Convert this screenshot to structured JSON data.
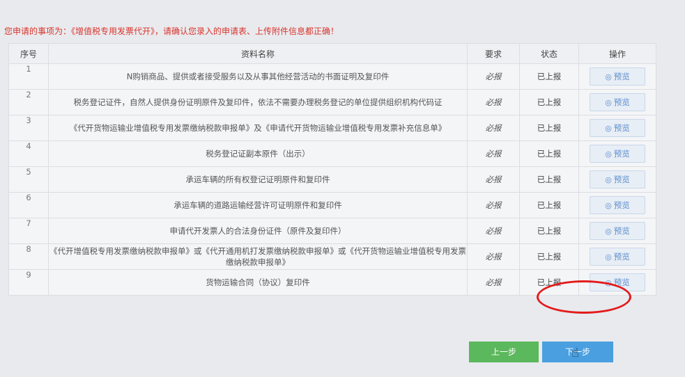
{
  "notice": {
    "prefix": "您申请的事项为：",
    "item": "《增值税专用发票代开》",
    "suffix": "，请确认您录入的申请表、上传附件信息都正确！"
  },
  "table": {
    "headers": {
      "index": "序号",
      "name": "资料名称",
      "required": "要求",
      "status": "状态",
      "action": "操作"
    },
    "rows": [
      {
        "index": "1",
        "name": "N购销商品、提供或者接受服务以及从事其他经营活动的书面证明及复印件",
        "required": "必报",
        "status": "已上报",
        "action": "预览"
      },
      {
        "index": "2",
        "name": "税务登记证件，自然人提供身份证明原件及复印件，依法不需要办理税务登记的单位提供组织机构代码证",
        "required": "必报",
        "status": "已上报",
        "action": "预览"
      },
      {
        "index": "3",
        "name": "《代开货物运输业增值税专用发票缴纳税款申报单》及《申请代开货物运输业增值税专用发票补充信息单》",
        "required": "必报",
        "status": "已上报",
        "action": "预览"
      },
      {
        "index": "4",
        "name": "税务登记证副本原件（出示）",
        "required": "必报",
        "status": "已上报",
        "action": "预览"
      },
      {
        "index": "5",
        "name": "承运车辆的所有权登记证明原件和复印件",
        "required": "必报",
        "status": "已上报",
        "action": "预览"
      },
      {
        "index": "6",
        "name": "承运车辆的道路运输经营许可证明原件和复印件",
        "required": "必报",
        "status": "已上报",
        "action": "预览"
      },
      {
        "index": "7",
        "name": "申请代开发票人的合法身份证件（原件及复印件）",
        "required": "必报",
        "status": "已上报",
        "action": "预览"
      },
      {
        "index": "8",
        "name": "《代开增值税专用发票缴纳税款申报单》或《代开通用机打发票缴纳税款申报单》或《代开货物运输业增值税专用发票缴纳税款申报单》",
        "required": "必报",
        "status": "已上报",
        "action": "预览"
      },
      {
        "index": "9",
        "name": "货物运输合同（协议）复印件",
        "required": "必报",
        "status": "已上报",
        "action": "预览"
      }
    ]
  },
  "buttons": {
    "prev": "上一步",
    "next": "下一步"
  },
  "icons": {
    "preview": "eye-icon",
    "cursor": "hand-pointer-icon"
  },
  "colors": {
    "notice": "#d9342c",
    "prev": "#5cb85c",
    "next": "#4a9fe0",
    "highlight": "#e21b1b"
  }
}
